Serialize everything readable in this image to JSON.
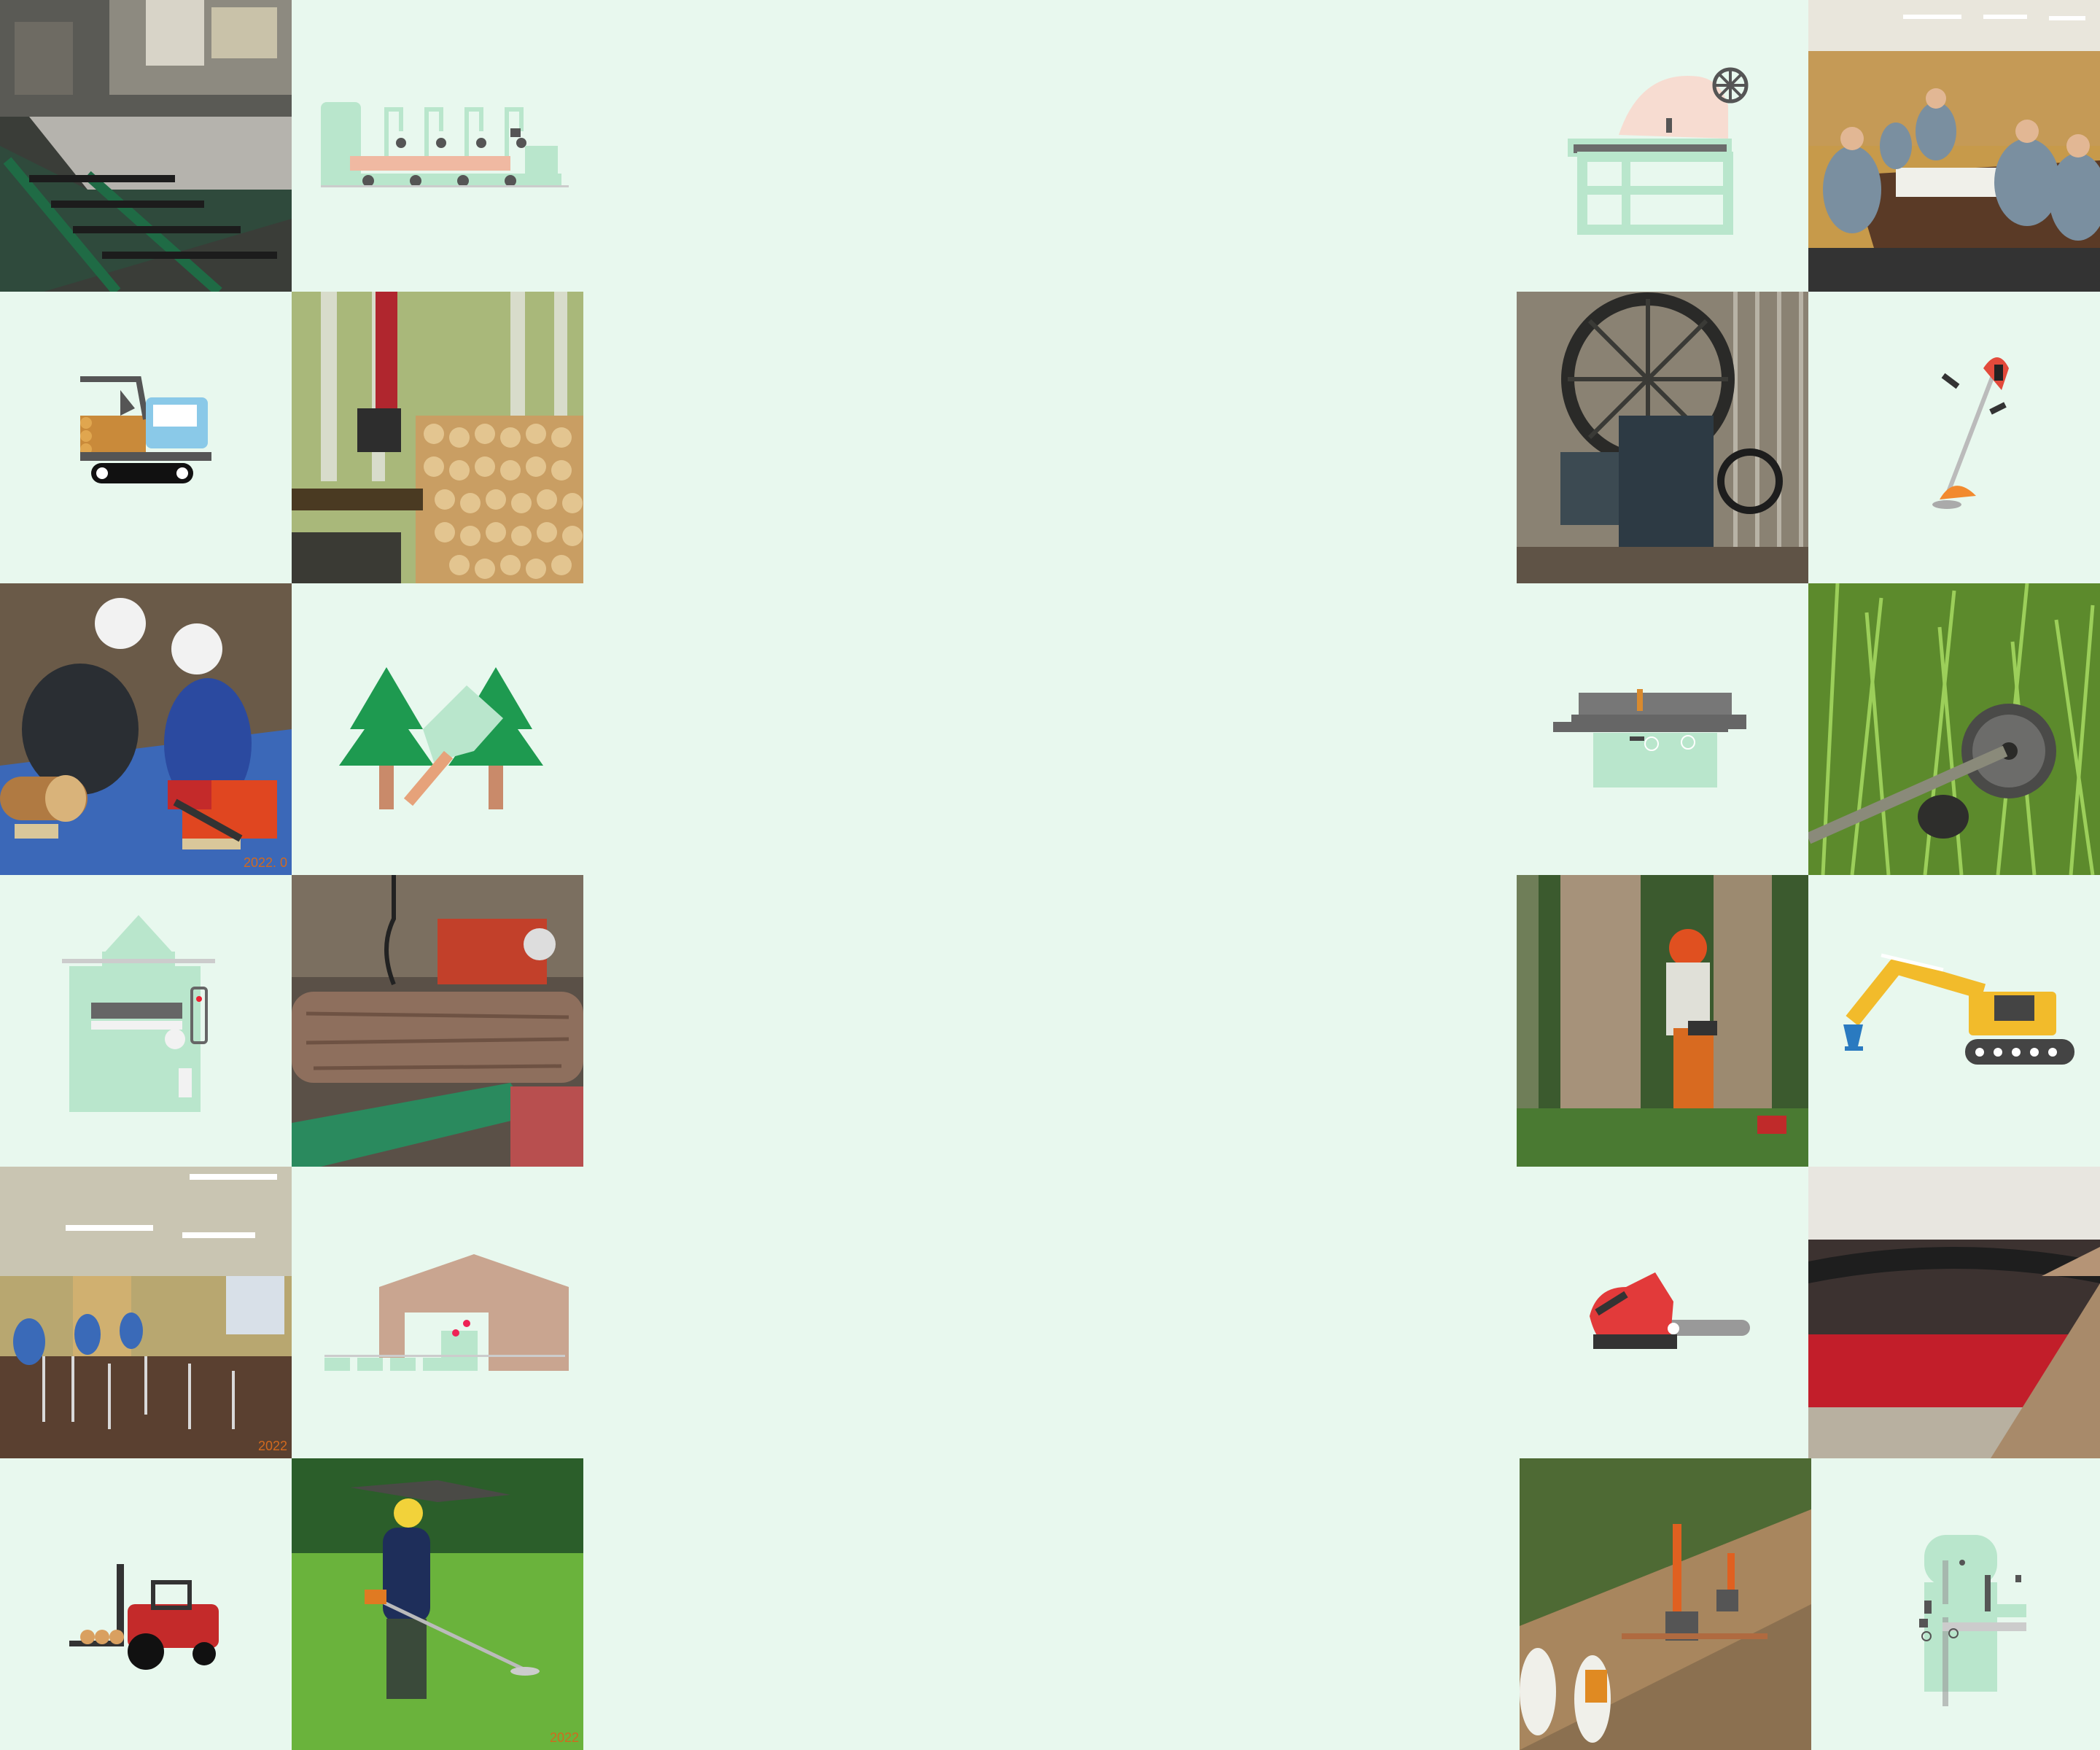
{
  "page": {
    "background": "#e8f8ee",
    "stamp_color": "#d2691e",
    "tiles": [
      {
        "id": "sawmill-conveyor-photo",
        "kind": "photo"
      },
      {
        "id": "sawmill-line-icon",
        "kind": "icon"
      },
      {
        "id": "table-saw-icon",
        "kind": "icon"
      },
      {
        "id": "meeting-room-photo",
        "kind": "photo"
      },
      {
        "id": "crawler-carrier-icon",
        "kind": "icon"
      },
      {
        "id": "log-loader-photo",
        "kind": "photo"
      },
      {
        "id": "old-bandsaw-photo",
        "kind": "photo"
      },
      {
        "id": "brush-cutter-icon",
        "kind": "icon"
      },
      {
        "id": "chainsaw-training-photo",
        "kind": "photo"
      },
      {
        "id": "tree-felling-icon",
        "kind": "icon"
      },
      {
        "id": "planer-table-icon",
        "kind": "icon"
      },
      {
        "id": "brush-cutter-grass-photo",
        "kind": "photo"
      },
      {
        "id": "planer-machine-icon",
        "kind": "icon"
      },
      {
        "id": "log-workshop-photo",
        "kind": "photo"
      },
      {
        "id": "tree-felling-photo",
        "kind": "photo"
      },
      {
        "id": "excavator-icon",
        "kind": "icon"
      },
      {
        "id": "lecture-hall-photo",
        "kind": "photo"
      },
      {
        "id": "sawmill-building-icon",
        "kind": "icon"
      },
      {
        "id": "chainsaw-icon",
        "kind": "icon"
      },
      {
        "id": "circular-saw-photo",
        "kind": "photo"
      },
      {
        "id": "forklift-icon",
        "kind": "icon"
      },
      {
        "id": "mowing-photo",
        "kind": "photo"
      },
      {
        "id": "forest-road-photo",
        "kind": "photo"
      },
      {
        "id": "bandsaw-icon",
        "kind": "icon"
      }
    ]
  },
  "stamps": {
    "chainsaw_training": "2022. 0",
    "lecture_hall": "2022",
    "mowing": "2022"
  }
}
